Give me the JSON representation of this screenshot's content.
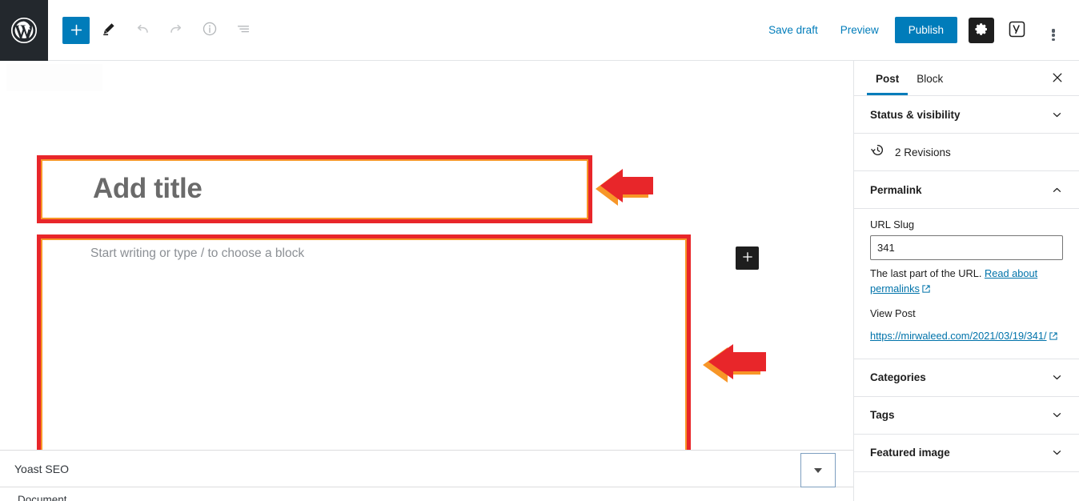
{
  "header": {
    "logo_icon": "wordpress-logo-icon",
    "inserter_label": "+",
    "inserter_icon": "plus-icon",
    "tools": [
      {
        "name": "edit-tools-icon",
        "label": "Tools"
      },
      {
        "name": "undo-icon",
        "label": "Undo"
      },
      {
        "name": "redo-icon",
        "label": "Redo"
      },
      {
        "name": "info-icon",
        "label": "Details"
      },
      {
        "name": "list-view-icon",
        "label": "List view"
      }
    ],
    "save_draft_label": "Save draft",
    "preview_label": "Preview",
    "publish_label": "Publish",
    "settings_icon": "gear-icon",
    "yoast_icon": "yoast-seo-icon",
    "more_menu_icon": "vertical-ellipsis-icon",
    "accent_color": "#007cba",
    "logo_bg_color": "#23282d"
  },
  "editor": {
    "title_placeholder": "Add title",
    "paragraph_placeholder": "Start writing or type / to choose a block",
    "block_inserter_icon": "plus-icon",
    "annotation_border_color": "#e8262a",
    "annotation_inner_color": "#f79628",
    "arrow_color": "#e8262a",
    "arrow_shadow_color": "#f79628"
  },
  "bottom_panel": {
    "yoast_title": "Yoast SEO",
    "toggle_icon": "caret-down-icon",
    "document_label": "Document"
  },
  "sidebar": {
    "tabs": [
      {
        "label": "Post",
        "active": true
      },
      {
        "label": "Block",
        "active": false
      }
    ],
    "close_icon": "close-icon",
    "panels": [
      {
        "label": "Status & visibility",
        "icon": "chevron-down-icon",
        "expanded": false
      },
      {
        "label": "Categories",
        "icon": "chevron-down-icon",
        "expanded": false
      },
      {
        "label": "Tags",
        "icon": "chevron-down-icon",
        "expanded": false
      },
      {
        "label": "Featured image",
        "icon": "chevron-down-icon",
        "expanded": false
      }
    ],
    "revisions": {
      "label": "2 Revisions",
      "icon": "revision-clock-icon"
    },
    "permalink": {
      "title": "Permalink",
      "icon": "chevron-up-icon",
      "expanded": true,
      "url_slug_label": "URL Slug",
      "url_slug_value": "341",
      "help_prefix": "The last part of the URL. ",
      "help_link": "Read about permalinks",
      "help_link_icon": "external-link-icon",
      "view_post_label": "View Post",
      "post_url": "https://mirwaleed.com/2021/03/19/341/",
      "post_url_icon": "external-link-icon"
    }
  }
}
